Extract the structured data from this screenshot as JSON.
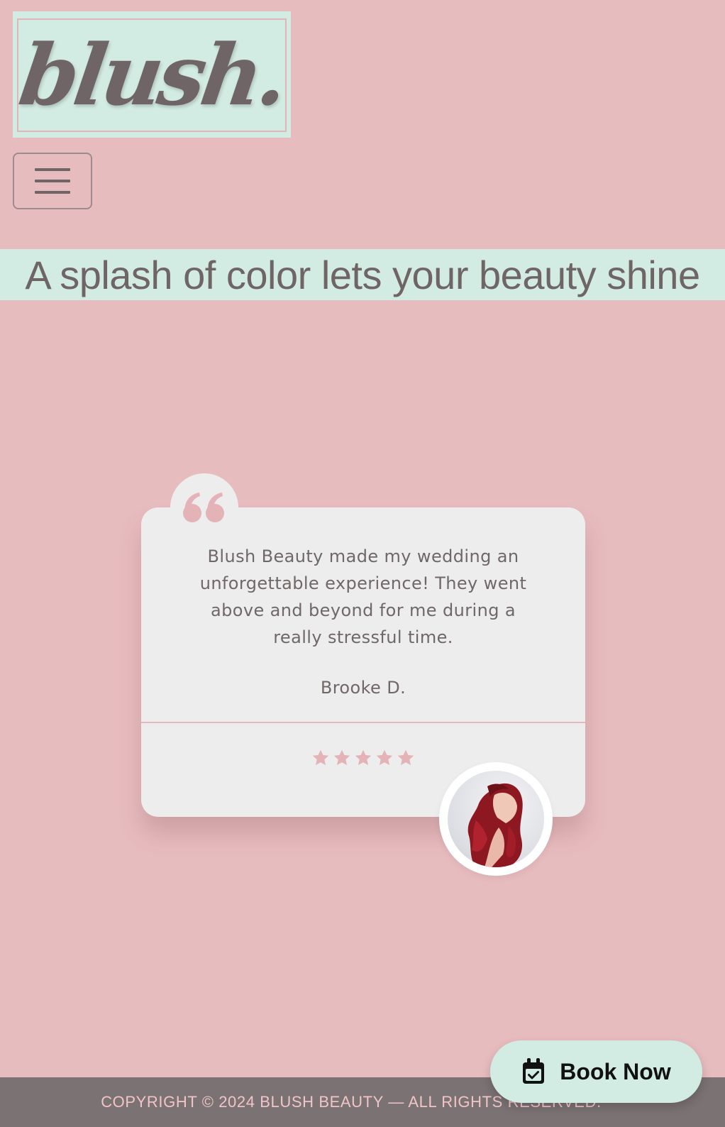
{
  "logo": {
    "text": "blush."
  },
  "nav": {
    "menu_icon": "hamburger-icon"
  },
  "hero": {
    "tagline": "A splash of color lets your beauty shine"
  },
  "testimonial": {
    "quote_icon": "quote-icon",
    "text": "Blush Beauty made my wedding an unforgettable experience! They went above and beyond for me during a really stressful time.",
    "author": "Brooke D.",
    "rating": 5,
    "avatar": "customer-photo"
  },
  "cta": {
    "label": "Book Now",
    "icon": "calendar-check-icon"
  },
  "footer": {
    "copyright": "COPYRIGHT © 2024 BLUSH BEAUTY — ALL RIGHTS RESERVED."
  },
  "colors": {
    "background": "#e7bcbf",
    "mint": "#d3ece3",
    "text_gray": "#6f6566",
    "card": "#ededee",
    "star": "#e4b3b7",
    "footer": "#7b7273",
    "footer_text": "#f1c5c8"
  }
}
